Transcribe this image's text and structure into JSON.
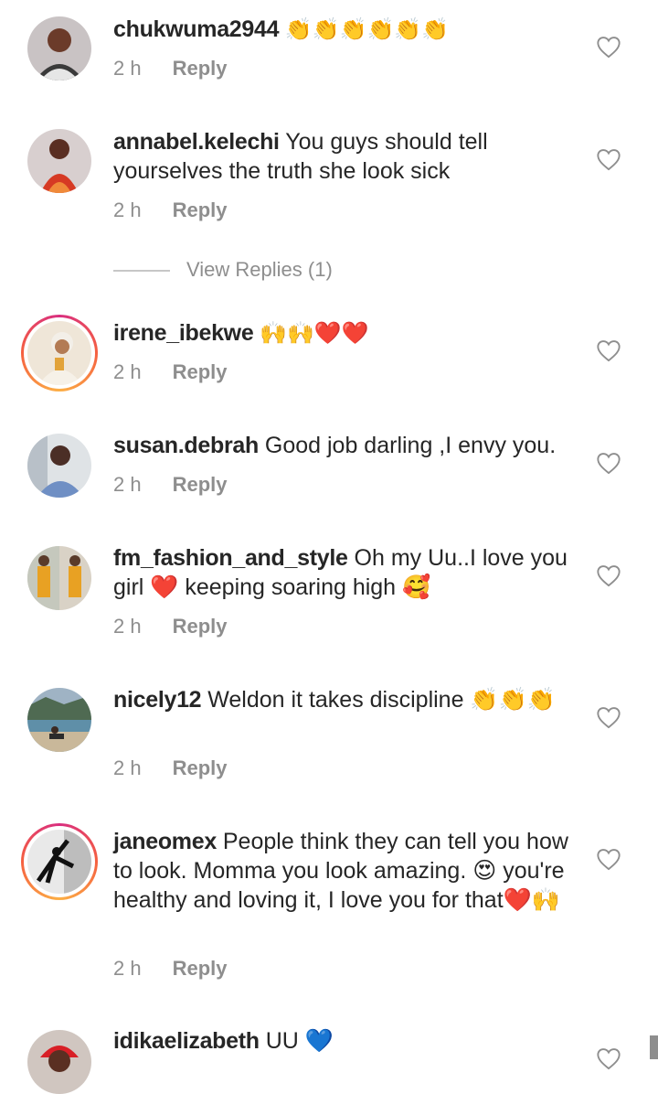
{
  "comments": [
    {
      "username": "chukwuma2944",
      "text": " 👏👏👏👏👏👏",
      "time": "2 h",
      "reply": "Reply"
    },
    {
      "username": "annabel.kelechi",
      "text": " You guys should tell yourselves the truth she look sick",
      "time": "2 h",
      "reply": "Reply"
    },
    {
      "username": "irene_ibekwe",
      "text": " 🙌🙌❤️❤️",
      "time": "2 h",
      "reply": "Reply"
    },
    {
      "username": "susan.debrah",
      "text": " Good job darling ,I envy you.",
      "time": "2 h",
      "reply": "Reply"
    },
    {
      "username": "fm_fashion_and_style",
      "text": " Oh my Uu..I love you girl ❤️ keeping soaring high 🥰",
      "time": "2 h",
      "reply": "Reply"
    },
    {
      "username": "nicely12",
      "text": " Weldon it takes discipline 👏👏👏",
      "time": "2 h",
      "reply": "Reply"
    },
    {
      "username": "janeomex",
      "text": " People think they can tell you how to look. Momma you look amazing. 😍 you're healthy and loving it, I love you for that❤️🙌",
      "time": "2 h",
      "reply": "Reply"
    },
    {
      "username": "idikaelizabeth",
      "text": " UU 💙",
      "time": "",
      "reply": ""
    }
  ],
  "view_replies": "View Replies (1)",
  "icons": {
    "like": "heart-outline-icon"
  },
  "colors": {
    "text": "#262626",
    "secondary": "#8e8e8e",
    "story_ring": "#d92e7f"
  }
}
